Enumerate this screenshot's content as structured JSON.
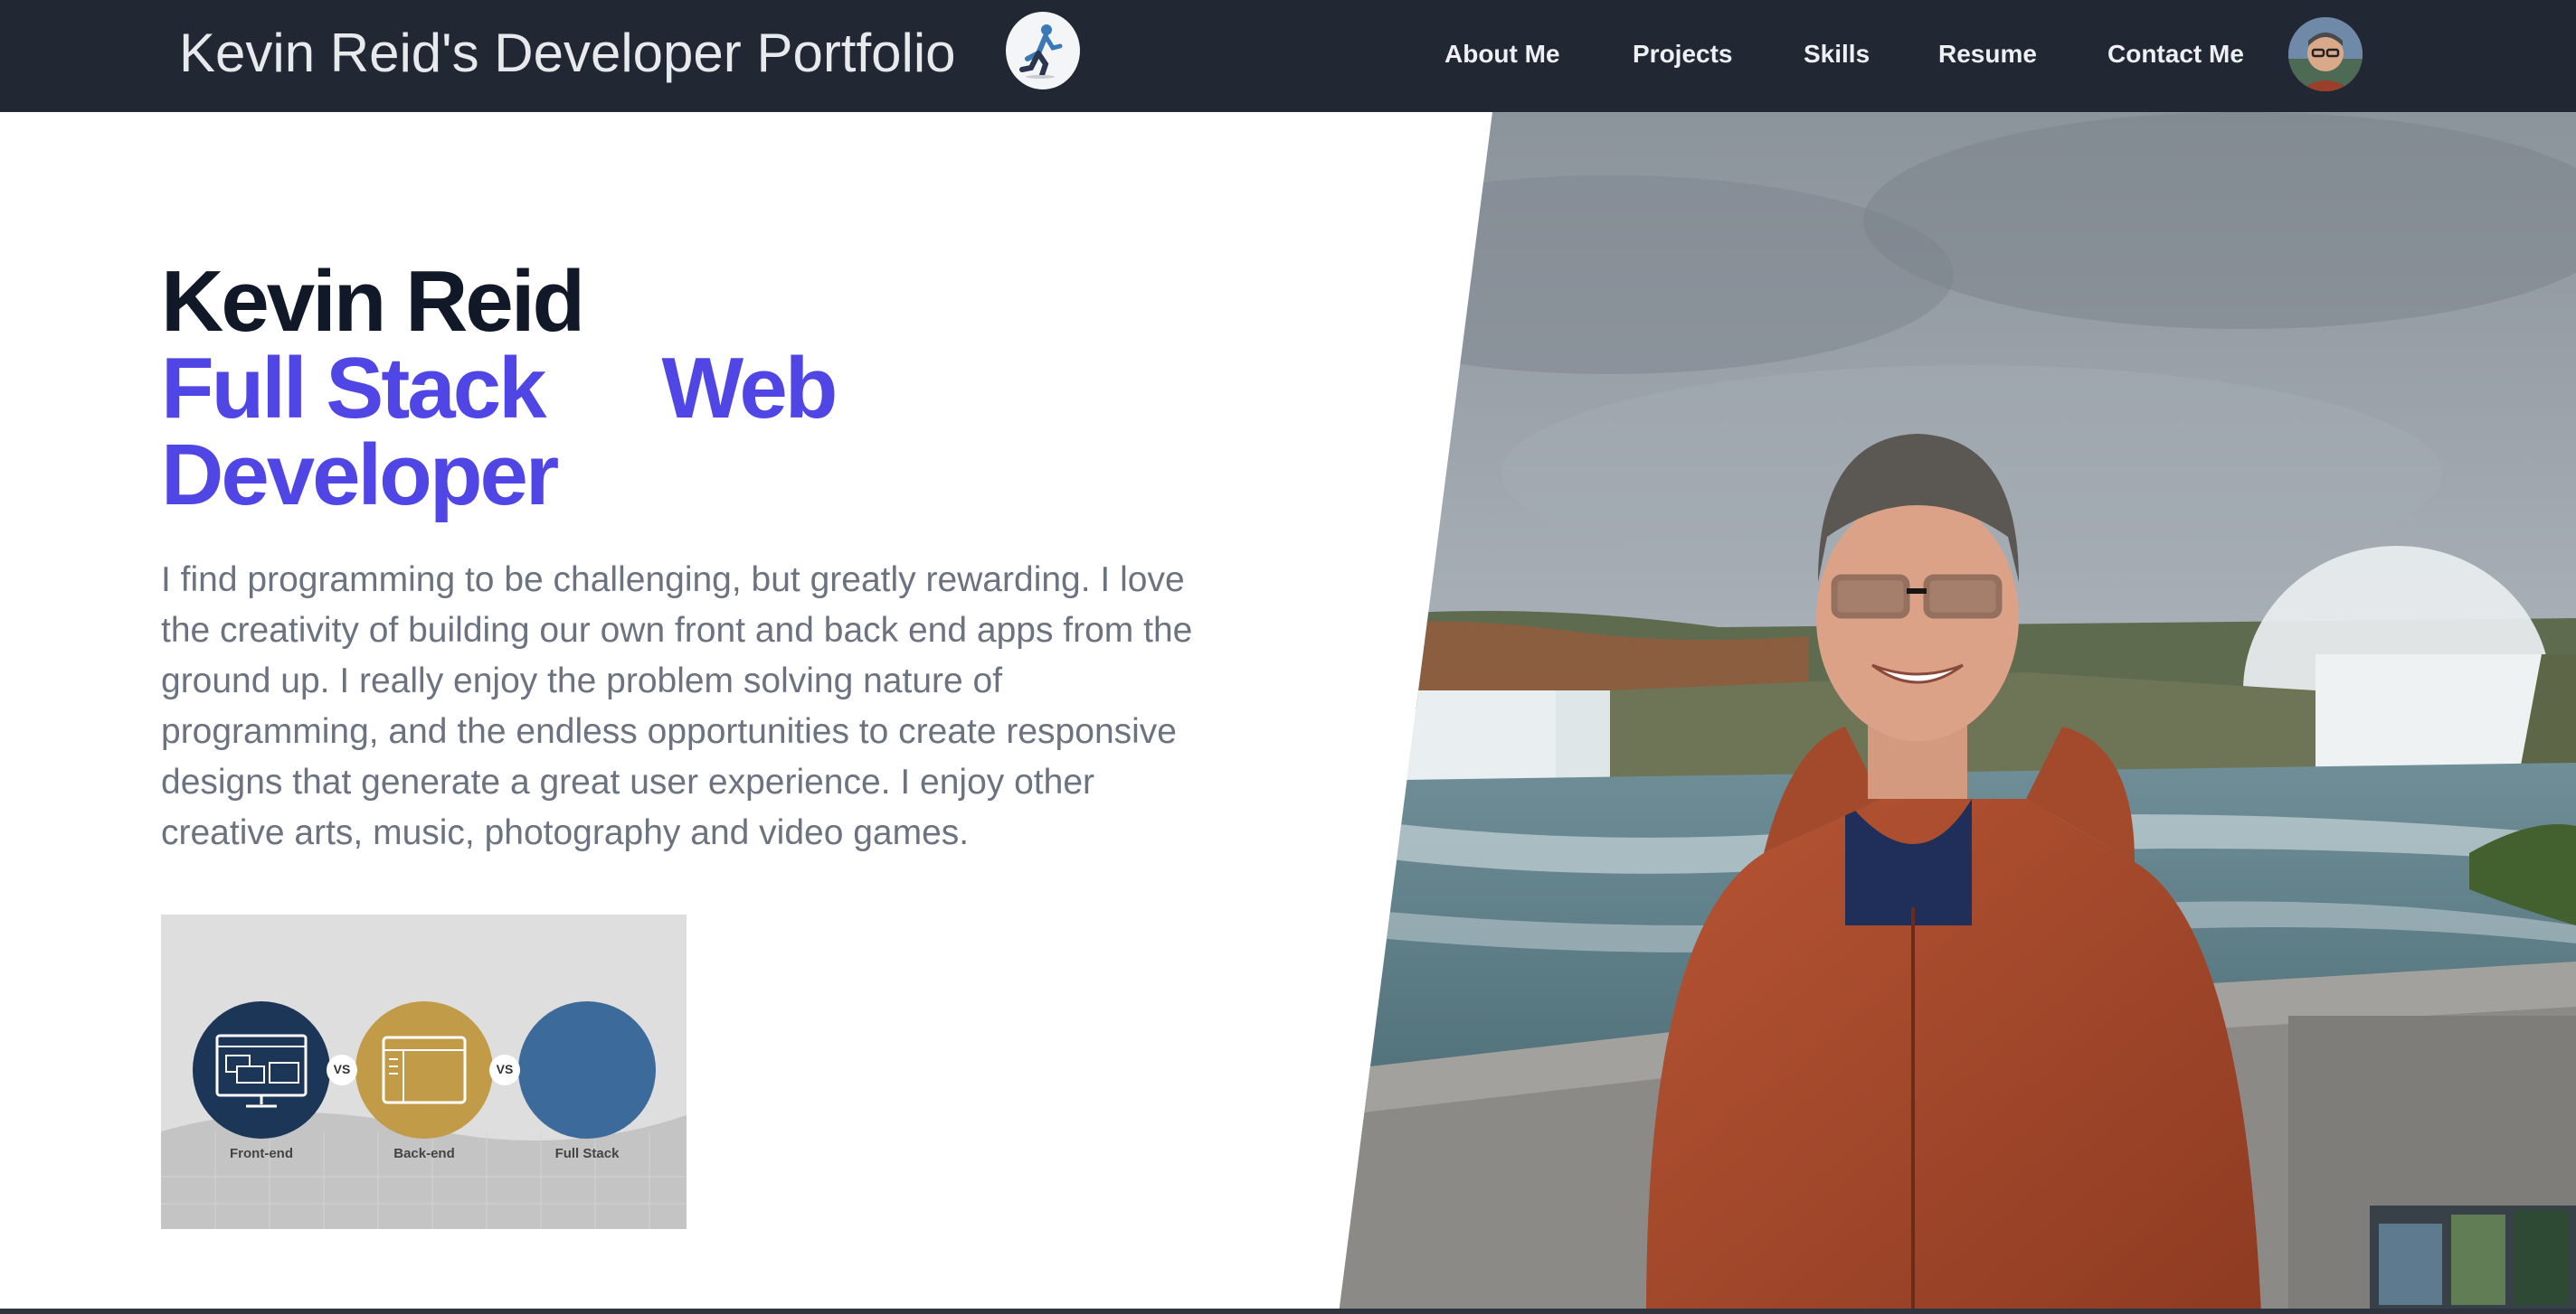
{
  "navbar": {
    "brand": "Kevin Reid's Developer Portfolio",
    "links": [
      {
        "label": "About Me"
      },
      {
        "label": "Projects"
      },
      {
        "label": "Skills"
      },
      {
        "label": "Resume"
      },
      {
        "label": "Contact Me"
      }
    ]
  },
  "hero": {
    "name": "Kevin Reid",
    "role_line1_a": "Full Stack",
    "role_line1_b": "Web",
    "role_line2": "Developer",
    "bio": "I find programming to be challenging, but greatly rewarding. I love the creativity of building our own front and back end apps from the ground up. I really enjoy the problem solving nature of programming, and the endless opportunities to create responsive designs that generate a great user experience. I enjoy other creative arts, music, photography and video games."
  },
  "stack_graphic": {
    "labels": [
      "Front-end",
      "Back-end",
      "Full Stack"
    ],
    "vs": "VS"
  },
  "colors": {
    "nav_bg": "#212733",
    "accent": "#4f46e5",
    "heading": "#111827",
    "body_text": "#6b7280"
  }
}
